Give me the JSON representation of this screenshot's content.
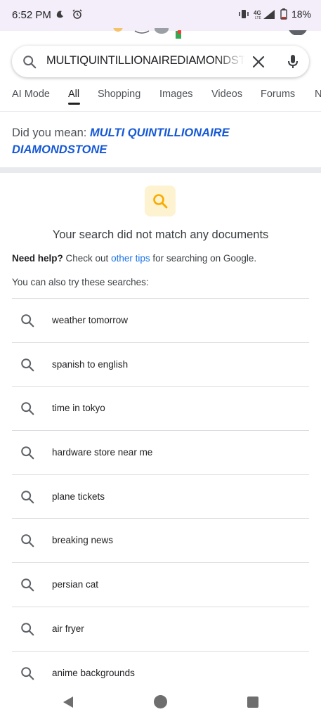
{
  "status_bar": {
    "time": "6:52 PM",
    "icons": [
      "moon-icon",
      "alarm-icon",
      "vibrate-icon",
      "lte-signal-icon",
      "battery-icon"
    ],
    "network": "4G LTE",
    "battery": "18%"
  },
  "search": {
    "query": "MULTIQUINTILLIONAIREDIAMONDSTONE"
  },
  "tabs": [
    {
      "label": "AI Mode"
    },
    {
      "label": "All",
      "active": true
    },
    {
      "label": "Shopping"
    },
    {
      "label": "Images"
    },
    {
      "label": "Videos"
    },
    {
      "label": "Forums"
    },
    {
      "label": "N"
    }
  ],
  "did_you_mean": {
    "prefix": "Did you mean: ",
    "suggestion_line1": "MULTI QUINTILLIONAIRE",
    "suggestion_line2": "DIAMONDSTONE"
  },
  "no_results": {
    "message": "Your search did not match any documents",
    "help_bold": "Need help?",
    "help_pre": " Check out ",
    "help_link": "other tips",
    "help_post": " for searching on Google.",
    "also_try": "You can also try these searches:"
  },
  "suggestions": [
    {
      "label": "weather tomorrow"
    },
    {
      "label": "spanish to english"
    },
    {
      "label": "time in tokyo"
    },
    {
      "label": "hardware store near me"
    },
    {
      "label": "plane tickets"
    },
    {
      "label": "breaking news"
    },
    {
      "label": "persian cat"
    },
    {
      "label": "air fryer"
    },
    {
      "label": "anime backgrounds"
    }
  ],
  "colors": {
    "accent_link": "#1558d6",
    "tip_icon": "#f9ab00",
    "tip_bg": "#fdf3d0",
    "status_bar_bg": "#f3eefa"
  }
}
